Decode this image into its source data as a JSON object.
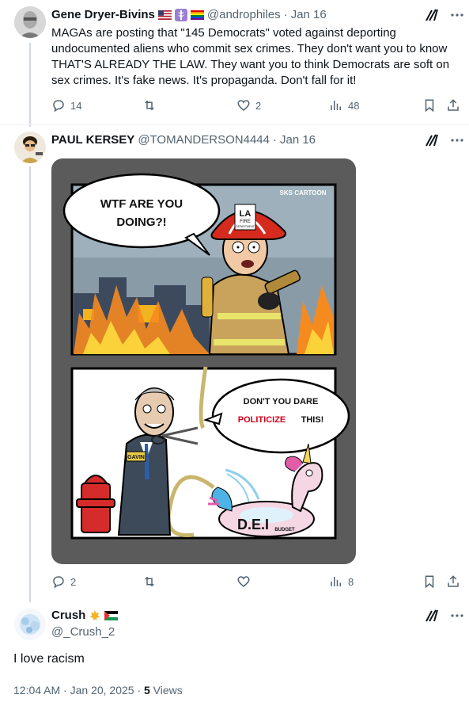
{
  "tweets": [
    {
      "name": "Gene Dryer-Bivins",
      "handle": "@androphiles",
      "date": "Jan 16",
      "text": "MAGAs are posting that \"145 Democrats\" voted against deporting undocumented aliens who commit sex crimes. They don't want you to know THAT'S ALREADY THE LAW. They want you to think Democrats are soft on sex crimes. It's fake news. It's propaganda. Don't fall for it!",
      "replies": "14",
      "likes": "2",
      "views": "48"
    },
    {
      "name": "PAUL KERSEY",
      "handle": "@TOMANDERSON4444",
      "date": "Jan 16",
      "replies": "2",
      "views": "8",
      "comic": {
        "watermark": "SKS CARTOON",
        "bubble1": [
          "WTF ARE YOU",
          "DOING?!"
        ],
        "helmet_text_1": "LA",
        "helmet_text_2": "FIRE",
        "helmet_text_3": "DEPARTMENT",
        "bubble2_line1": "DON'T YOU DARE",
        "bubble2_word_red": "POLITICIZE",
        "bubble2_word_end": "THIS!",
        "name_tag": "GAVIN",
        "float_text": "D.E.I",
        "float_sub": "BUDGET"
      }
    },
    {
      "name": "Crush",
      "handle": "@_Crush_2",
      "text": "I love racism",
      "timestamp": "12:04 AM · Jan 20, 2025 · ",
      "views_count": "5",
      "views_label": " Views"
    }
  ],
  "separator": "·",
  "colors": {
    "muted": "#536471",
    "line": "#cfd9de",
    "accent_red": "#d0021b"
  }
}
